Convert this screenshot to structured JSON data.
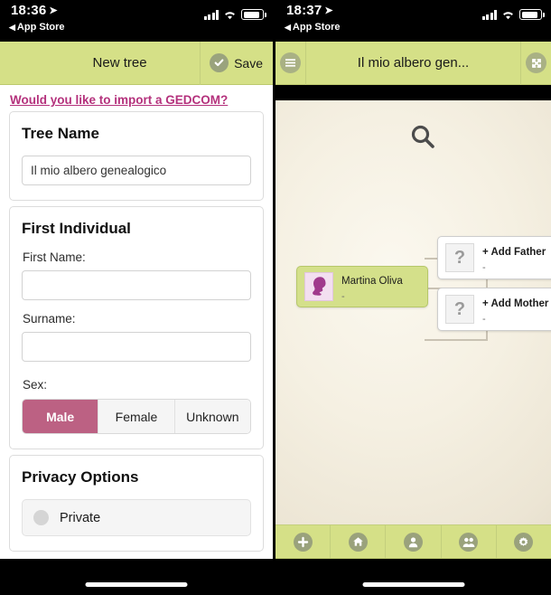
{
  "left": {
    "status": {
      "time": "18:36",
      "back_label": "App Store",
      "location_icon": "location-arrow-icon"
    },
    "header": {
      "title": "New tree",
      "save_label": "Save",
      "save_icon": "check-circle-icon"
    },
    "gedcom_link": "Would you like to import a GEDCOM?",
    "tree_name_card": {
      "heading": "Tree Name",
      "value": "Il mio albero genealogico",
      "placeholder": "Tree name"
    },
    "first_individual_card": {
      "heading": "First Individual",
      "first_name_label": "First Name:",
      "first_name_value": "",
      "first_name_placeholder": "",
      "surname_label": "Surname:",
      "surname_value": "",
      "surname_placeholder": "",
      "sex_label": "Sex:",
      "sex_options": [
        "Male",
        "Female",
        "Unknown"
      ],
      "sex_selected": "Male"
    },
    "privacy_card": {
      "heading": "Privacy Options",
      "option_label": "Private"
    }
  },
  "right": {
    "status": {
      "time": "18:37",
      "back_label": "App Store",
      "location_icon": "location-arrow-icon"
    },
    "header": {
      "menu_icon": "hamburger-menu-icon",
      "title": "Il mio albero gen...",
      "fullscreen_icon": "expand-arrows-icon"
    },
    "tree": {
      "self": {
        "name": "Martina Oliva",
        "sub": "-",
        "avatar_icon": "female-silhouette-icon"
      },
      "father": {
        "name": "+ Add Father",
        "sub": "-",
        "avatar_icon": "question-mark-icon"
      },
      "mother": {
        "name": "+ Add Mother",
        "sub": "-",
        "avatar_icon": "question-mark-icon"
      },
      "zoom_icon": "magnifier-icon"
    },
    "toolbar": [
      {
        "icon": "plus-icon"
      },
      {
        "icon": "home-icon"
      },
      {
        "icon": "person-icon"
      },
      {
        "icon": "people-icon"
      },
      {
        "icon": "gear-icon"
      }
    ]
  },
  "colors": {
    "green_bar": "#d5e087",
    "accent_pink": "#bc6183",
    "link_magenta": "#b4317c",
    "node_self": "#d4e08a",
    "canvas": "#f5f0e2"
  }
}
